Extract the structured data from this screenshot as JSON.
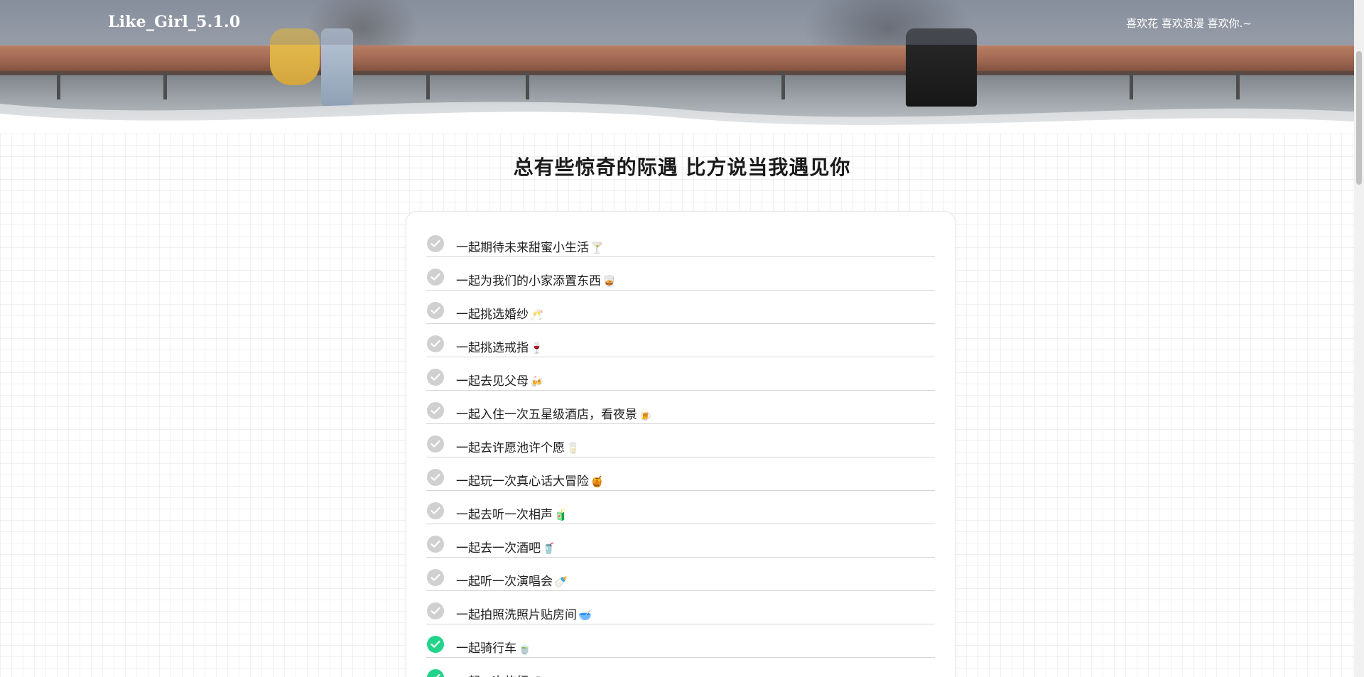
{
  "navbar": {
    "brand": "Like_Girl_5.1.0",
    "tagline": "喜欢花 喜欢浪漫 喜欢你.~"
  },
  "main": {
    "title": "总有些惊奇的际遇 比方说当我遇见你"
  },
  "checklist": {
    "items": [
      {
        "text": "一起期待未来甜蜜小生活",
        "emoji": "🍸",
        "done": false
      },
      {
        "text": "一起为我们的小家添置东西",
        "emoji": "🥃",
        "done": false
      },
      {
        "text": "一起挑选婚纱",
        "emoji": "🥂",
        "done": false
      },
      {
        "text": "一起挑选戒指",
        "emoji": "🍷",
        "done": false
      },
      {
        "text": "一起去见父母",
        "emoji": "🍻",
        "done": false
      },
      {
        "text": "一起入住一次五星级酒店，看夜景",
        "emoji": "🍺",
        "done": false
      },
      {
        "text": "一起去许愿池许个愿",
        "emoji": "🥛",
        "done": false
      },
      {
        "text": "一起玩一次真心话大冒险",
        "emoji": "🍯",
        "done": false
      },
      {
        "text": "一起去听一次相声",
        "emoji": "🧃",
        "done": false
      },
      {
        "text": "一起去一次酒吧",
        "emoji": "🥤",
        "done": false
      },
      {
        "text": "一起听一次演唱会",
        "emoji": "🍼",
        "done": false
      },
      {
        "text": "一起拍照洗照片贴房间",
        "emoji": "🥣",
        "done": false
      },
      {
        "text": "一起骑行车",
        "emoji": "🍵",
        "done": true
      },
      {
        "text": "一起一次旅行",
        "emoji": "🍶",
        "done": true
      }
    ]
  },
  "colors": {
    "done": "#22d389",
    "pending": "#d0d0d0"
  }
}
